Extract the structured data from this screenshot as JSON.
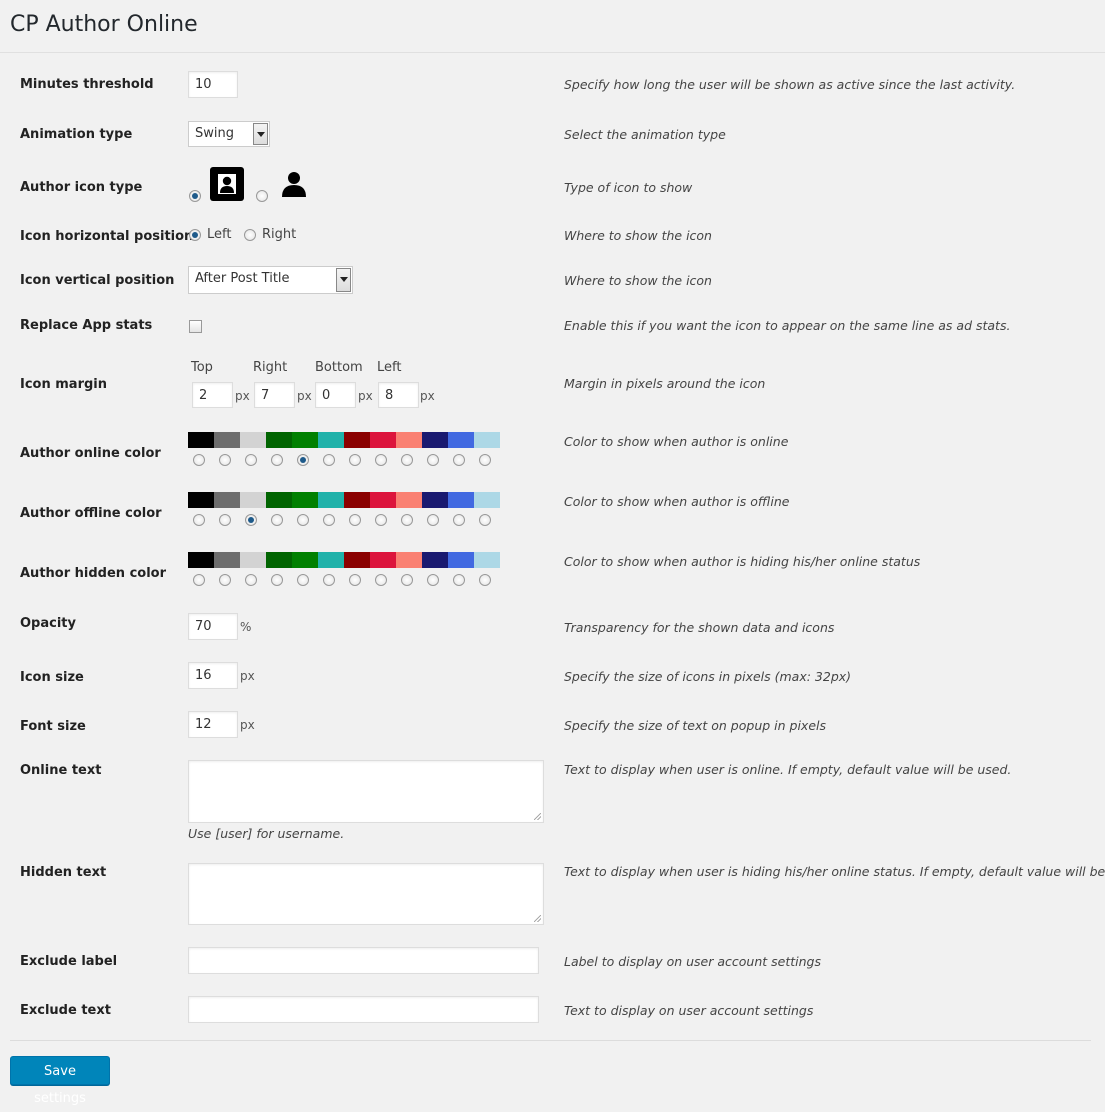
{
  "page_title": "CP Author Online",
  "minutes_threshold": {
    "label": "Minutes threshold",
    "value": "10",
    "desc": "Specify how long the user will be shown as active since the last activity."
  },
  "animation_type": {
    "label": "Animation type",
    "value": "Swing",
    "desc": "Select the animation type"
  },
  "author_icon_type": {
    "label": "Author icon type",
    "desc": "Type of icon to show",
    "options": [
      "user-square-icon",
      "user-silhouette-icon"
    ],
    "selected": 0
  },
  "icon_horizontal": {
    "label": "Icon horizontal position",
    "options": [
      "Left",
      "Right"
    ],
    "selected": "Left",
    "desc": "Where to show the icon"
  },
  "icon_vertical": {
    "label": "Icon vertical position",
    "value": "After Post Title",
    "desc": "Where to show the icon"
  },
  "replace_app_stats": {
    "label": "Replace App stats",
    "checked": false,
    "desc": "Enable this if you want the icon to appear on the same line as ad stats."
  },
  "icon_margin": {
    "label": "Icon margin",
    "desc": "Margin in pixels around the icon",
    "unit": "px",
    "fields": [
      {
        "name": "Top",
        "value": "2"
      },
      {
        "name": "Right",
        "value": "7"
      },
      {
        "name": "Bottom",
        "value": "0"
      },
      {
        "name": "Left",
        "value": "8"
      }
    ]
  },
  "palette": [
    "#000000",
    "#6d6d6d",
    "#d3d3d3",
    "#006400",
    "#008000",
    "#20b2aa",
    "#8b0000",
    "#dc143c",
    "#fa8072",
    "#191970",
    "#4169e1",
    "#add8e6"
  ],
  "author_online_color": {
    "label": "Author online color",
    "desc": "Color to show when author is online",
    "selected_index": 4
  },
  "author_offline_color": {
    "label": "Author offline color",
    "desc": "Color to show when author is offline",
    "selected_index": 2
  },
  "author_hidden_color": {
    "label": "Author hidden color",
    "desc": "Color to show when author is hiding his/her online status",
    "selected_index": -1
  },
  "opacity": {
    "label": "Opacity",
    "value": "70",
    "unit": "%",
    "desc": "Transparency for the shown data and icons"
  },
  "icon_size": {
    "label": "Icon size",
    "value": "16",
    "unit": "px",
    "desc": "Specify the size of icons in pixels (max: 32px)"
  },
  "font_size": {
    "label": "Font size",
    "value": "12",
    "unit": "px",
    "desc": "Specify the size of text on popup in pixels"
  },
  "online_text": {
    "label": "Online text",
    "value": "",
    "hint": "Use [user] for username.",
    "desc": "Text to display when user is online. If empty, default value will be used."
  },
  "hidden_text": {
    "label": "Hidden text",
    "value": "",
    "desc": "Text to display when user is hiding his/her online status. If empty, default value will be used."
  },
  "exclude_label": {
    "label": "Exclude label",
    "value": "",
    "desc": "Label to display on user account settings"
  },
  "exclude_text": {
    "label": "Exclude text",
    "value": "",
    "desc": "Text to display on user account settings"
  },
  "save_button": "Save settings"
}
